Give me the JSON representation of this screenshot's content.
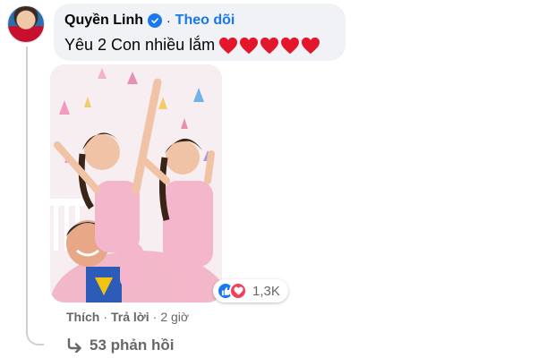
{
  "comment": {
    "author": "Quyền Linh",
    "separator": "·",
    "follow_label": "Theo dõi",
    "text": "Yêu 2 Con nhiều lắm",
    "heart_count": 5
  },
  "reactions": {
    "count": "1,3K",
    "types": [
      "like-icon",
      "love-icon"
    ]
  },
  "actions": {
    "like_label": "Thích",
    "reply_label": "Trả lời",
    "separator": "·",
    "time": "2 giờ"
  },
  "replies": {
    "label": "53 phản hồi"
  },
  "colors": {
    "accent": "#1877f2",
    "bubble": "#f0f2f5",
    "heart": "#e4162b",
    "muted": "#65676b"
  }
}
